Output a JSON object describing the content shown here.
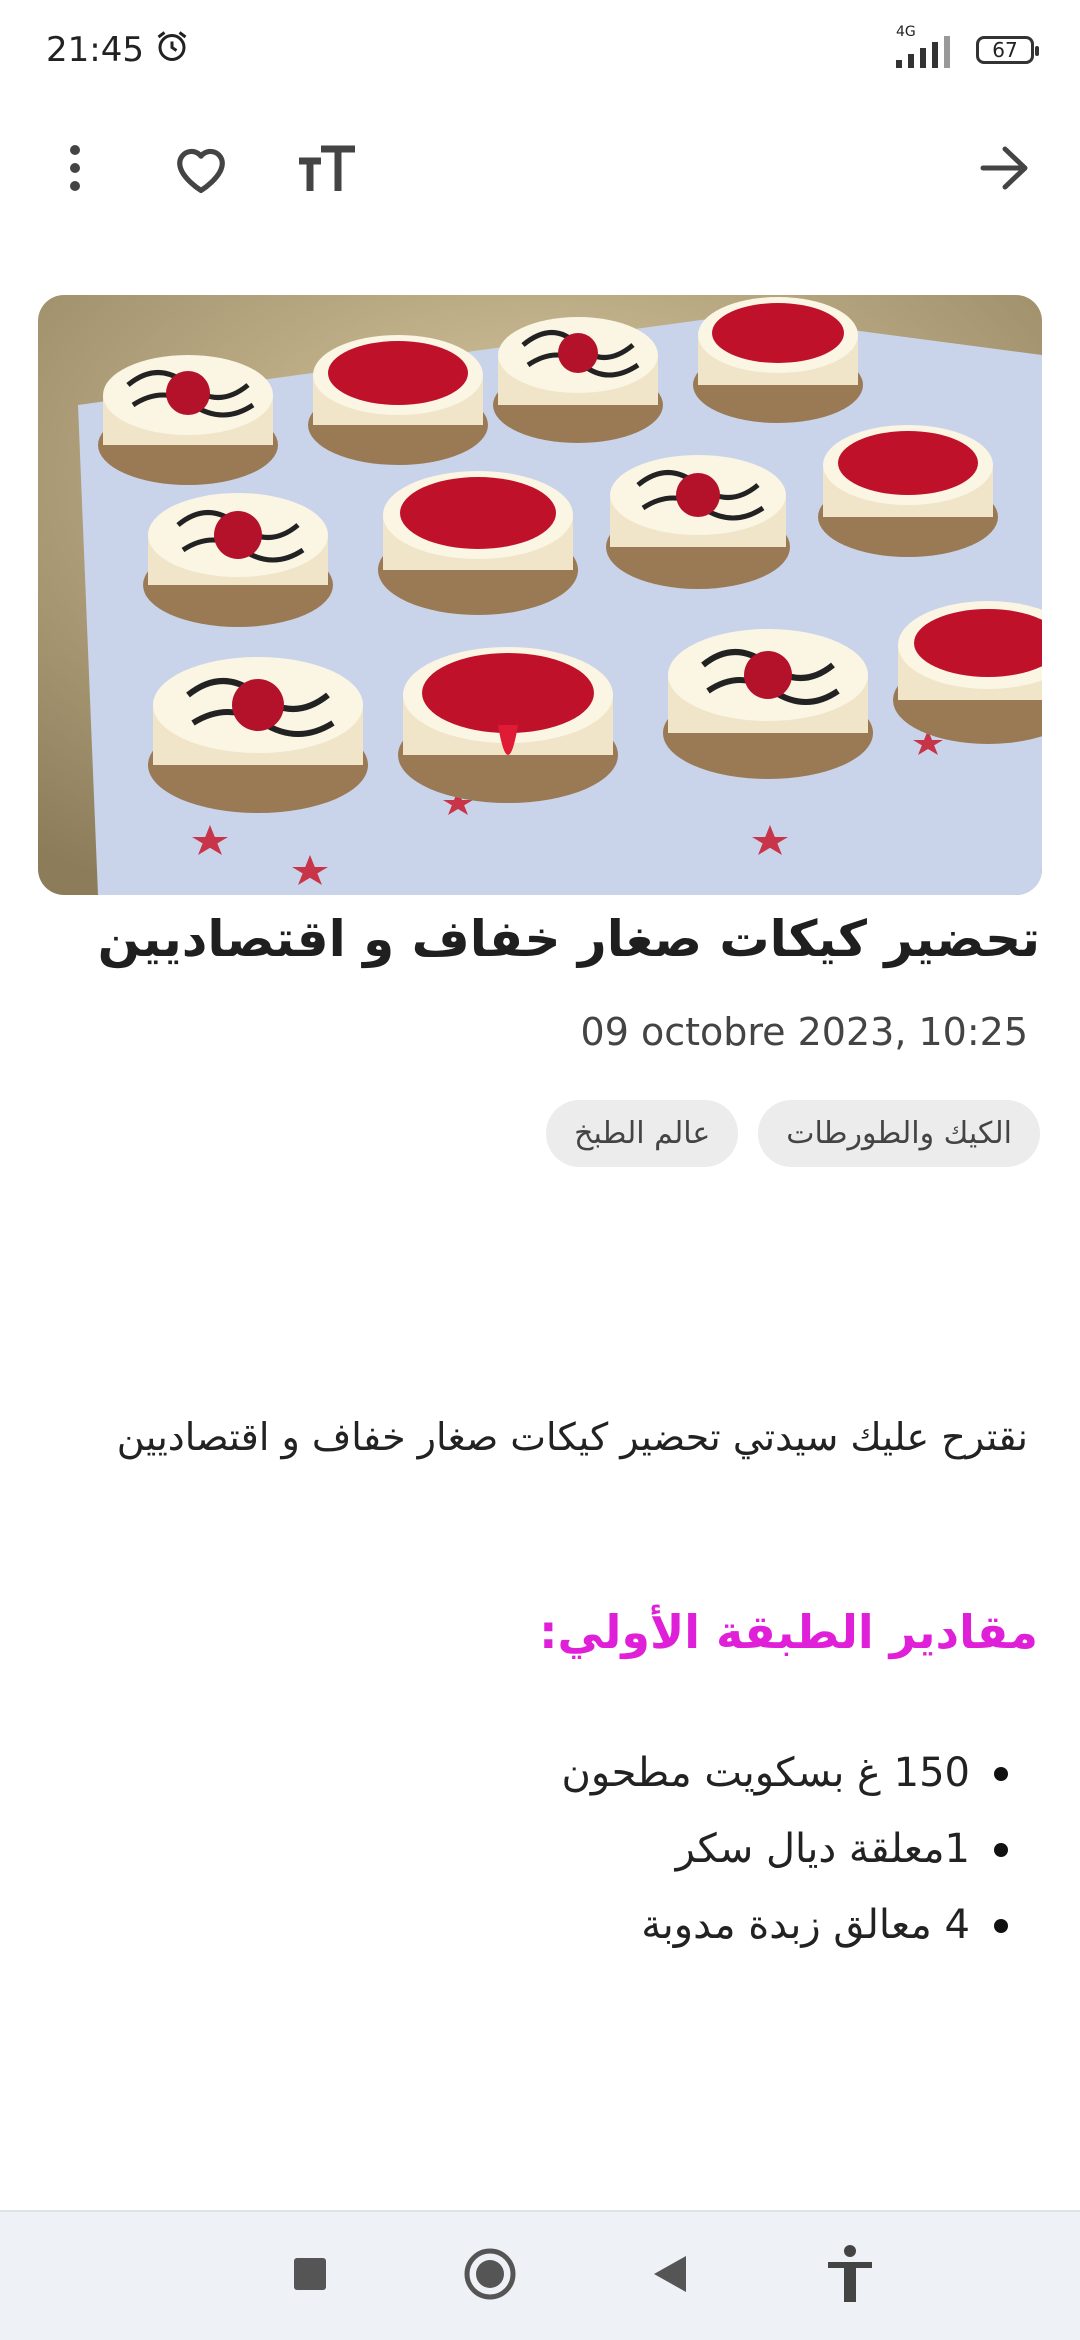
{
  "status": {
    "time": "21:45",
    "network": "4G",
    "battery": "67"
  },
  "article": {
    "title": "تحضير كيكات صغار خفاف و اقتصاديين",
    "date": "09 octobre 2023, 10:25",
    "categories": [
      "الكيك والطورطات",
      "عالم الطبخ"
    ],
    "intro": "نقترح عليك سيدتي تحضير كيكات صغار خفاف و اقتصاديين",
    "section_heading": "مقادير الطبقة الأولي:",
    "ingredients": [
      "150 غ بسكويت مطحون",
      "1معلقة ديال سكر",
      "4 معالق زبدة مدوبة"
    ],
    "accent_color": "#e020d8"
  },
  "icons": {
    "toolbar": [
      "more-vert-icon",
      "heart-icon",
      "text-size-icon",
      "arrow-forward-icon"
    ],
    "navbar": [
      "stop-square-icon",
      "home-circle-icon",
      "back-triangle-icon",
      "accessibility-icon"
    ]
  }
}
